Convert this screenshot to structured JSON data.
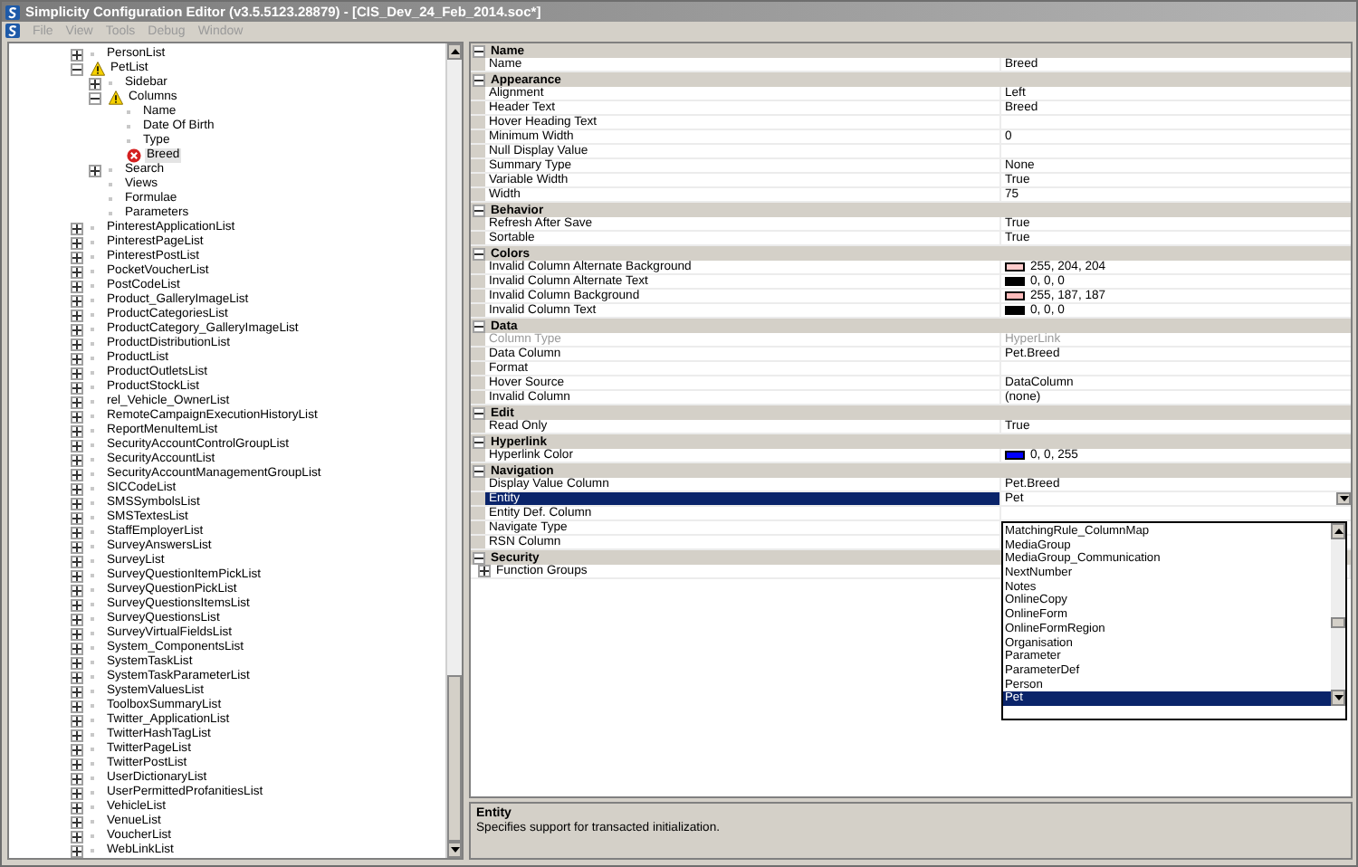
{
  "window": {
    "title": "Simplicity Configuration Editor (v3.5.5123.28879) - [CIS_Dev_24_Feb_2014.soc*]"
  },
  "menu": [
    {
      "label": "File",
      "disabled": true
    },
    {
      "label": "View",
      "disabled": true
    },
    {
      "label": "Tools",
      "disabled": true
    },
    {
      "label": "Debug",
      "disabled": true
    },
    {
      "label": "Window",
      "disabled": true
    }
  ],
  "tree": [
    {
      "label": "PersonList",
      "kind": "folder",
      "expanded": false,
      "selected": false
    },
    {
      "label": "PetList",
      "kind": "folder",
      "expanded": true,
      "selected": false,
      "warning": true,
      "children": [
        {
          "label": "Sidebar",
          "kind": "folder",
          "expanded": false,
          "selected": false
        },
        {
          "label": "Columns",
          "kind": "folder",
          "expanded": true,
          "selected": false,
          "warning": true,
          "children": [
            {
              "label": "Name",
              "kind": "leaf",
              "selected": false
            },
            {
              "label": "Date Of Birth",
              "kind": "leaf",
              "selected": false
            },
            {
              "label": "Type",
              "kind": "leaf",
              "selected": false
            },
            {
              "label": "Breed",
              "kind": "leaf",
              "selected": true,
              "error": true
            }
          ]
        },
        {
          "label": "Search",
          "kind": "folder",
          "expanded": false,
          "selected": false
        },
        {
          "label": "Views",
          "kind": "leaf",
          "selected": false
        },
        {
          "label": "Formulae",
          "kind": "leaf",
          "selected": false
        },
        {
          "label": "Parameters",
          "kind": "leaf",
          "selected": false
        }
      ]
    },
    {
      "label": "PinterestApplicationList",
      "kind": "folder",
      "expanded": false,
      "selected": false
    },
    {
      "label": "PinterestPageList",
      "kind": "folder",
      "expanded": false,
      "selected": false
    },
    {
      "label": "PinterestPostList",
      "kind": "folder",
      "expanded": false,
      "selected": false
    },
    {
      "label": "PocketVoucherList",
      "kind": "folder",
      "expanded": false,
      "selected": false
    },
    {
      "label": "PostCodeList",
      "kind": "folder",
      "expanded": false,
      "selected": false
    },
    {
      "label": "Product_GalleryImageList",
      "kind": "folder",
      "expanded": false,
      "selected": false
    },
    {
      "label": "ProductCategoriesList",
      "kind": "folder",
      "expanded": false,
      "selected": false
    },
    {
      "label": "ProductCategory_GalleryImageList",
      "kind": "folder",
      "expanded": false,
      "selected": false
    },
    {
      "label": "ProductDistributionList",
      "kind": "folder",
      "expanded": false,
      "selected": false
    },
    {
      "label": "ProductList",
      "kind": "folder",
      "expanded": false,
      "selected": false
    },
    {
      "label": "ProductOutletsList",
      "kind": "folder",
      "expanded": false,
      "selected": false
    },
    {
      "label": "ProductStockList",
      "kind": "folder",
      "expanded": false,
      "selected": false
    },
    {
      "label": "rel_Vehicle_OwnerList",
      "kind": "folder",
      "expanded": false,
      "selected": false
    },
    {
      "label": "RemoteCampaignExecutionHistoryList",
      "kind": "folder",
      "expanded": false,
      "selected": false
    },
    {
      "label": "ReportMenuItemList",
      "kind": "folder",
      "expanded": false,
      "selected": false
    },
    {
      "label": "SecurityAccountControlGroupList",
      "kind": "folder",
      "expanded": false,
      "selected": false
    },
    {
      "label": "SecurityAccountList",
      "kind": "folder",
      "expanded": false,
      "selected": false
    },
    {
      "label": "SecurityAccountManagementGroupList",
      "kind": "folder",
      "expanded": false,
      "selected": false
    },
    {
      "label": "SICCodeList",
      "kind": "folder",
      "expanded": false,
      "selected": false
    },
    {
      "label": "SMSSymbolsList",
      "kind": "folder",
      "expanded": false,
      "selected": false
    },
    {
      "label": "SMSTextesList",
      "kind": "folder",
      "expanded": false,
      "selected": false
    },
    {
      "label": "StaffEmployerList",
      "kind": "folder",
      "expanded": false,
      "selected": false
    },
    {
      "label": "SurveyAnswersList",
      "kind": "folder",
      "expanded": false,
      "selected": false
    },
    {
      "label": "SurveyList",
      "kind": "folder",
      "expanded": false,
      "selected": false
    },
    {
      "label": "SurveyQuestionItemPickList",
      "kind": "folder",
      "expanded": false,
      "selected": false
    },
    {
      "label": "SurveyQuestionPickList",
      "kind": "folder",
      "expanded": false,
      "selected": false
    },
    {
      "label": "SurveyQuestionsItemsList",
      "kind": "folder",
      "expanded": false,
      "selected": false
    },
    {
      "label": "SurveyQuestionsList",
      "kind": "folder",
      "expanded": false,
      "selected": false
    },
    {
      "label": "SurveyVirtualFieldsList",
      "kind": "folder",
      "expanded": false,
      "selected": false
    },
    {
      "label": "System_ComponentsList",
      "kind": "folder",
      "expanded": false,
      "selected": false
    },
    {
      "label": "SystemTaskList",
      "kind": "folder",
      "expanded": false,
      "selected": false
    },
    {
      "label": "SystemTaskParameterList",
      "kind": "folder",
      "expanded": false,
      "selected": false
    },
    {
      "label": "SystemValuesList",
      "kind": "folder",
      "expanded": false,
      "selected": false
    },
    {
      "label": "ToolboxSummaryList",
      "kind": "folder",
      "expanded": false,
      "selected": false
    },
    {
      "label": "Twitter_ApplicationList",
      "kind": "folder",
      "expanded": false,
      "selected": false
    },
    {
      "label": "TwitterHashTagList",
      "kind": "folder",
      "expanded": false,
      "selected": false
    },
    {
      "label": "TwitterPageList",
      "kind": "folder",
      "expanded": false,
      "selected": false
    },
    {
      "label": "TwitterPostList",
      "kind": "folder",
      "expanded": false,
      "selected": false
    },
    {
      "label": "UserDictionaryList",
      "kind": "folder",
      "expanded": false,
      "selected": false
    },
    {
      "label": "UserPermittedProfanitiesList",
      "kind": "folder",
      "expanded": false,
      "selected": false
    },
    {
      "label": "VehicleList",
      "kind": "folder",
      "expanded": false,
      "selected": false
    },
    {
      "label": "VenueList",
      "kind": "folder",
      "expanded": false,
      "selected": false
    },
    {
      "label": "VoucherList",
      "kind": "folder",
      "expanded": false,
      "selected": false
    },
    {
      "label": "WebLinkList",
      "kind": "folder",
      "expanded": false,
      "selected": false
    }
  ],
  "properties": [
    {
      "category": "Name",
      "expanded": true,
      "rows": [
        {
          "name": "Name",
          "value": "Breed",
          "kind": "text",
          "disabled": false,
          "selected": false
        }
      ]
    },
    {
      "category": "Appearance",
      "expanded": true,
      "rows": [
        {
          "name": "Alignment",
          "value": "Left",
          "kind": "text",
          "disabled": false,
          "selected": false
        },
        {
          "name": "Header Text",
          "value": "Breed",
          "kind": "text",
          "disabled": false,
          "selected": false
        },
        {
          "name": "Hover Heading Text",
          "kind": "text",
          "disabled": false,
          "selected": false
        },
        {
          "name": "Minimum Width",
          "value": "0",
          "kind": "text",
          "disabled": false,
          "selected": false
        },
        {
          "name": "Null Display Value",
          "kind": "text",
          "disabled": false,
          "selected": false
        },
        {
          "name": "Summary Type",
          "value": "None",
          "kind": "text",
          "disabled": false,
          "selected": false
        },
        {
          "name": "Variable Width",
          "value": "True",
          "kind": "text",
          "disabled": false,
          "selected": false
        },
        {
          "name": "Width",
          "value": "75",
          "kind": "text",
          "disabled": false,
          "selected": false
        }
      ]
    },
    {
      "category": "Behavior",
      "expanded": true,
      "rows": [
        {
          "name": "Refresh After Save",
          "value": "True",
          "kind": "text",
          "disabled": false,
          "selected": false
        },
        {
          "name": "Sortable",
          "value": "True",
          "kind": "text",
          "disabled": false,
          "selected": false
        }
      ]
    },
    {
      "category": "Colors",
      "expanded": true,
      "rows": [
        {
          "name": "Invalid Column Alternate Background",
          "value": "255, 204, 204",
          "kind": "color",
          "color": "#ffcccc",
          "disabled": false,
          "selected": false
        },
        {
          "name": "Invalid Column Alternate Text",
          "value": "0, 0, 0",
          "kind": "color",
          "color": "#000000",
          "disabled": false,
          "selected": false
        },
        {
          "name": "Invalid Column Background",
          "value": "255, 187, 187",
          "kind": "color",
          "color": "#ffbbbb",
          "disabled": false,
          "selected": false
        },
        {
          "name": "Invalid Column Text",
          "value": "0, 0, 0",
          "kind": "color",
          "color": "#000000",
          "disabled": false,
          "selected": false
        }
      ]
    },
    {
      "category": "Data",
      "expanded": true,
      "rows": [
        {
          "name": "Column Type",
          "value": "HyperLink",
          "kind": "text",
          "disabled": true,
          "selected": false
        },
        {
          "name": "Data Column",
          "value": "Pet.Breed",
          "kind": "text",
          "disabled": false,
          "selected": false
        },
        {
          "name": "Format",
          "kind": "text",
          "disabled": false,
          "selected": false
        },
        {
          "name": "Hover Source",
          "value": "DataColumn",
          "kind": "text",
          "disabled": false,
          "selected": false
        },
        {
          "name": "Invalid Column",
          "value": "(none)",
          "kind": "text",
          "disabled": false,
          "selected": false
        }
      ]
    },
    {
      "category": "Edit",
      "expanded": true,
      "rows": [
        {
          "name": "Read Only",
          "value": "True",
          "kind": "text",
          "disabled": false,
          "selected": false
        }
      ]
    },
    {
      "category": "Hyperlink",
      "expanded": true,
      "rows": [
        {
          "name": "Hyperlink Color",
          "value": "0, 0, 255",
          "kind": "color",
          "color": "#0000ff",
          "disabled": false,
          "selected": false
        }
      ]
    },
    {
      "category": "Navigation",
      "expanded": true,
      "rows": [
        {
          "name": "Display Value Column",
          "value": "Pet.Breed",
          "kind": "text",
          "disabled": false,
          "selected": false
        },
        {
          "name": "Entity",
          "value": "Pet",
          "kind": "dropdown",
          "disabled": false,
          "selected": true
        },
        {
          "name": "Entity Def. Column",
          "kind": "text",
          "disabled": false,
          "selected": false
        },
        {
          "name": "Navigate Type",
          "kind": "text",
          "disabled": false,
          "selected": false
        },
        {
          "name": "RSN Column",
          "kind": "text",
          "disabled": false,
          "selected": false
        }
      ]
    },
    {
      "category": "Security",
      "expanded": true,
      "rows": [
        {
          "name": "Function Groups",
          "kind": "group",
          "disabled": false,
          "selected": false
        }
      ]
    }
  ],
  "dropdown": {
    "items": [
      {
        "label": "MatchingRule_ColumnMap",
        "selected": false
      },
      {
        "label": "MediaGroup",
        "selected": false
      },
      {
        "label": "MediaGroup_Communication",
        "selected": false
      },
      {
        "label": "NextNumber",
        "selected": false
      },
      {
        "label": "Notes",
        "selected": false
      },
      {
        "label": "OnlineCopy",
        "selected": false
      },
      {
        "label": "OnlineForm",
        "selected": false
      },
      {
        "label": "OnlineFormRegion",
        "selected": false
      },
      {
        "label": "Organisation",
        "selected": false
      },
      {
        "label": "Parameter",
        "selected": false
      },
      {
        "label": "ParameterDef",
        "selected": false
      },
      {
        "label": "Person",
        "selected": false
      },
      {
        "label": "Pet",
        "selected": true
      }
    ]
  },
  "description": {
    "title": "Entity",
    "text": "Specifies support for transacted initialization."
  }
}
